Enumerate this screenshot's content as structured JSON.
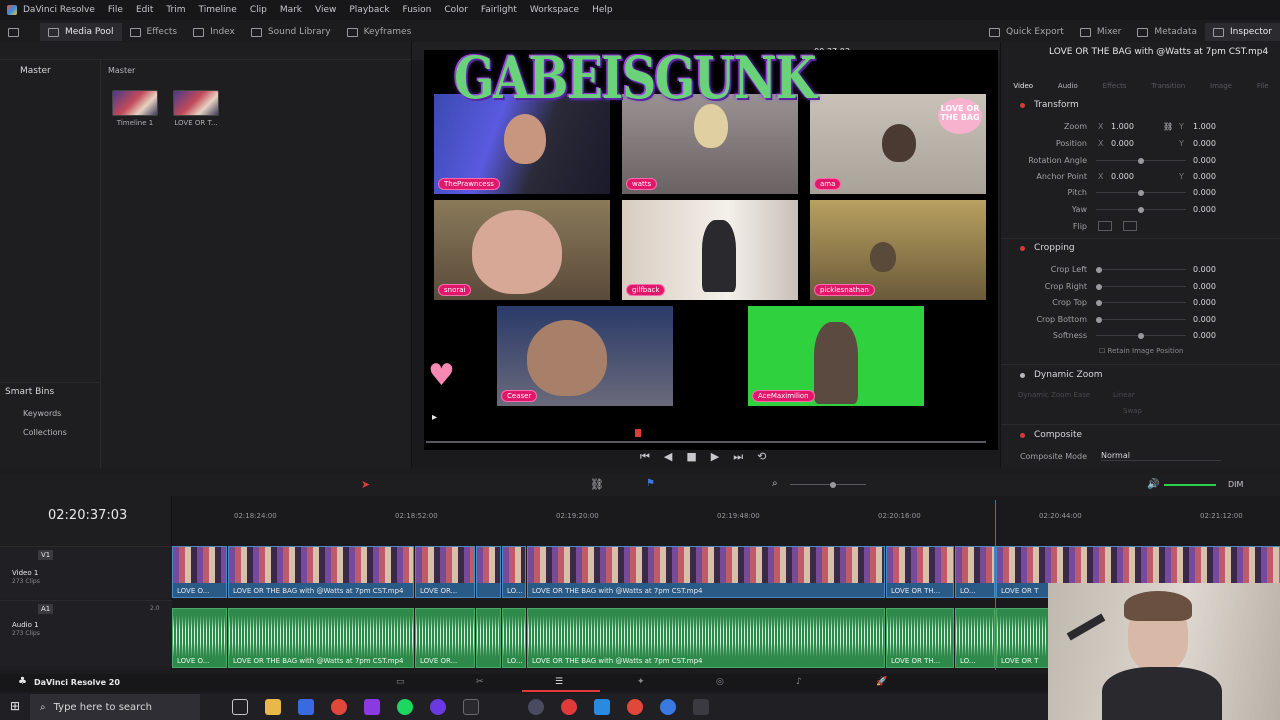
{
  "menu": [
    "DaVinci Resolve",
    "File",
    "Edit",
    "Trim",
    "Timeline",
    "Clip",
    "Mark",
    "View",
    "Playback",
    "Fusion",
    "Color",
    "Fairlight",
    "Workspace",
    "Help"
  ],
  "toolbar": {
    "left": [
      "Media Pool",
      "Effects",
      "Index",
      "Sound Library",
      "Keyframes"
    ],
    "right": [
      "Quick Export",
      "Mixer",
      "Metadata",
      "Inspector"
    ]
  },
  "mediapool": {
    "crumb_left": "Master",
    "crumb_right": "Master",
    "clips": [
      "Timeline 1",
      "LOVE OR T..."
    ],
    "smart_bins": "Smart Bins",
    "bins": [
      "Keywords",
      "Collections"
    ]
  },
  "viewer": {
    "timecode": "00:37:03",
    "logo": "GABEISGUNK",
    "participants": [
      "ThePrawncess",
      "watts",
      "ama",
      "snorai",
      "gilfback",
      "picklesnathan",
      "Ceaser",
      "AceMaximilion"
    ],
    "sticker": "LOVE OR THE BAG"
  },
  "inspector": {
    "title": "LOVE OR THE BAG with @Watts at 7pm CST.mp4",
    "tabs": [
      "Video",
      "Audio",
      "Effects",
      "Transition",
      "Image",
      "File"
    ],
    "transform": {
      "title": "Transform",
      "zoom_label": "Zoom",
      "zoom_x": "1.000",
      "zoom_y": "1.000",
      "position_label": "Position",
      "position_x": "0.000",
      "position_y": "0.000",
      "rotation_label": "Rotation Angle",
      "rotation": "0.000",
      "anchor_label": "Anchor Point",
      "anchor_x": "0.000",
      "anchor_y": "0.000",
      "pitch_label": "Pitch",
      "pitch": "0.000",
      "yaw_label": "Yaw",
      "yaw": "0.000",
      "flip_label": "Flip"
    },
    "cropping": {
      "title": "Cropping",
      "left_label": "Crop Left",
      "left": "0.000",
      "right_label": "Crop Right",
      "right": "0.000",
      "top_label": "Crop Top",
      "top": "0.000",
      "bottom_label": "Crop Bottom",
      "bottom": "0.000",
      "soft_label": "Softness",
      "soft": "0.000",
      "retain": "Retain Image Position"
    },
    "dynamic_zoom": {
      "title": "Dynamic Zoom",
      "ease_label": "Dynamic Zoom Ease",
      "ease": "Linear",
      "swap": "Swap"
    },
    "composite": {
      "title": "Composite",
      "mode_label": "Composite Mode",
      "mode": "Normal"
    }
  },
  "timeline": {
    "timecode": "02:20:37:03",
    "ruler": [
      "02:18:24:00",
      "02:18:52:00",
      "02:19:20:00",
      "02:19:48:00",
      "02:20:16:00",
      "02:20:44:00",
      "02:21:12:00"
    ],
    "v1": {
      "id": "V1",
      "name": "Video 1",
      "count": "273 Clips"
    },
    "a1": {
      "id": "A1",
      "name": "Audio 1",
      "count": "273 Clips",
      "level": "2.0"
    },
    "clip_names": [
      "LOVE O...",
      "LOVE OR THE BAG with @Watts at 7pm CST.mp4",
      "LOVE OR...",
      "LO...",
      "LOVE OR THE BAG with @Watts at 7pm CST.mp4",
      "LOVE OR TH...",
      "LO...",
      "LOVE OR T"
    ],
    "dim": "DIM"
  },
  "pagebar": {
    "app": "DaVinci Resolve 20"
  },
  "taskbar": {
    "search_placeholder": "Type here to search"
  }
}
